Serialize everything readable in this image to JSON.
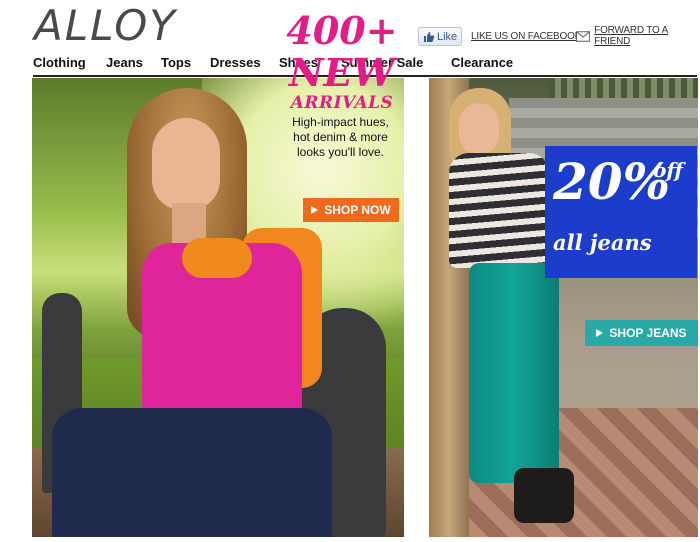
{
  "brand": {
    "logo": "ALLOY"
  },
  "social": {
    "like_label": "Like",
    "facebook_link": "LIKE US ON FACEBOOK",
    "forward_link": "FORWARD TO A FRIEND"
  },
  "nav": {
    "items": [
      {
        "label": "Clothing"
      },
      {
        "label": "Jeans"
      },
      {
        "label": "Tops"
      },
      {
        "label": "Dresses"
      },
      {
        "label": "Shoes"
      },
      {
        "label": "Summer Sale"
      },
      {
        "label": "Clearance"
      }
    ]
  },
  "hero_left": {
    "headline_number": "400+",
    "headline_word": "NEW",
    "headline_sub": "ARRIVALS",
    "body_lines": [
      "High-impact hues,",
      "hot denim & more",
      "looks you'll love."
    ],
    "cta": "SHOP NOW",
    "colors": {
      "accent": "#e31c86",
      "cta": "#ee6a1e"
    }
  },
  "hero_right": {
    "percent": "20%",
    "off": "off",
    "subject": "all jeans",
    "cta": "SHOP JEANS",
    "colors": {
      "promo_box": "#1c3ccc",
      "cta": "#29a9a6"
    }
  },
  "icons": {
    "like": "thumbs-up-icon",
    "forward": "envelope-icon",
    "cta_arrow": "play-triangle-icon"
  }
}
